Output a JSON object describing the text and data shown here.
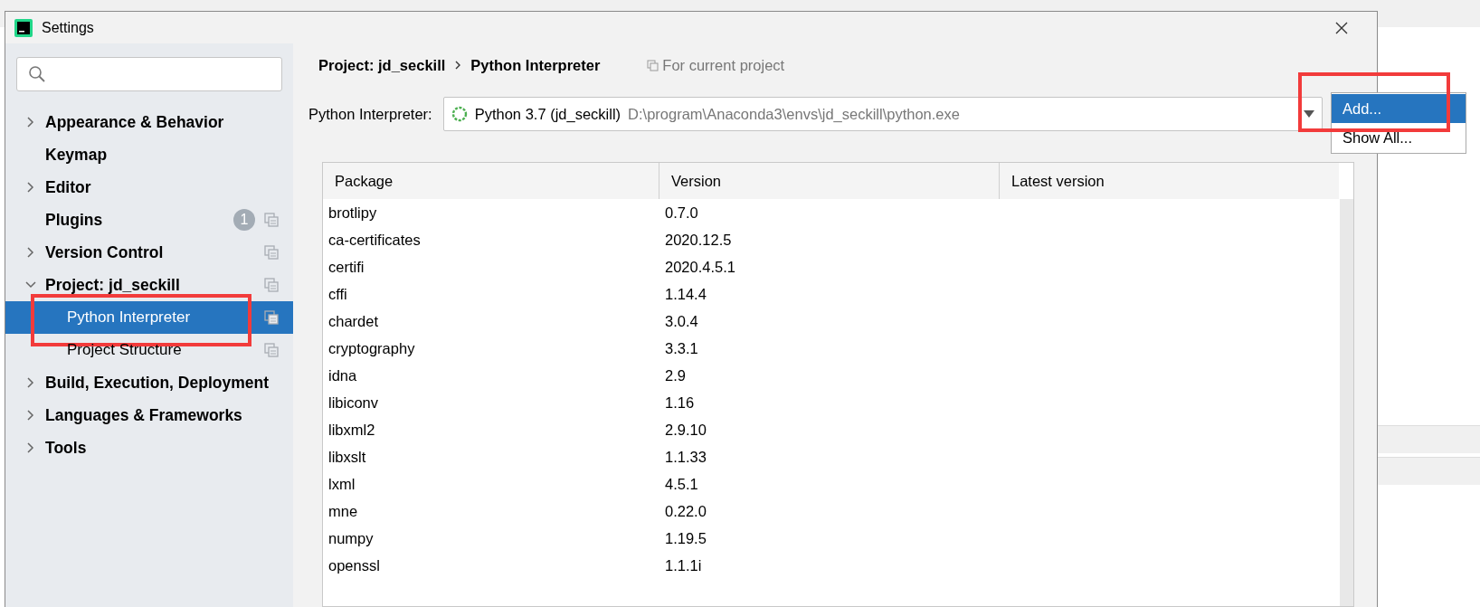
{
  "window": {
    "title": "Settings"
  },
  "sidebar": {
    "items": [
      {
        "label": "Appearance & Behavior",
        "kind": "group",
        "expanded": false,
        "selected": false,
        "project_scoped": false
      },
      {
        "label": "Keymap",
        "kind": "leaf",
        "selected": false,
        "project_scoped": false
      },
      {
        "label": "Editor",
        "kind": "group",
        "expanded": false,
        "selected": false,
        "project_scoped": false
      },
      {
        "label": "Plugins",
        "kind": "leaf",
        "selected": false,
        "project_scoped": true,
        "badge": "1"
      },
      {
        "label": "Version Control",
        "kind": "group",
        "expanded": false,
        "selected": false,
        "project_scoped": true
      },
      {
        "label": "Project: jd_seckill",
        "kind": "group",
        "expanded": true,
        "selected": false,
        "project_scoped": true,
        "children": [
          {
            "label": "Python Interpreter",
            "selected": true,
            "project_scoped": true,
            "highlighted": true
          },
          {
            "label": "Project Structure",
            "selected": false,
            "project_scoped": true,
            "highlighted": false
          }
        ]
      },
      {
        "label": "Build, Execution, Deployment",
        "kind": "group",
        "expanded": false,
        "selected": false,
        "project_scoped": false
      },
      {
        "label": "Languages & Frameworks",
        "kind": "group",
        "expanded": false,
        "selected": false,
        "project_scoped": false
      },
      {
        "label": "Tools",
        "kind": "group",
        "expanded": false,
        "selected": false,
        "project_scoped": false
      }
    ]
  },
  "breadcrumb": [
    "Project: jd_seckill",
    "Python Interpreter"
  ],
  "scope_note": "For current project",
  "interpreter": {
    "label": "Python Interpreter:",
    "name": "Python 3.7 (jd_seckill)",
    "path": "D:\\program\\Anaconda3\\envs\\jd_seckill\\python.exe"
  },
  "dropdown_menu": [
    {
      "label": "Add...",
      "selected": true,
      "highlighted": true
    },
    {
      "label": "Show All...",
      "selected": false,
      "highlighted": false
    }
  ],
  "table": {
    "columns": [
      "Package",
      "Version",
      "Latest version"
    ],
    "rows": [
      [
        "brotlipy",
        "0.7.0"
      ],
      [
        "ca-certificates",
        "2020.12.5"
      ],
      [
        "certifi",
        "2020.4.5.1"
      ],
      [
        "cffi",
        "1.14.4"
      ],
      [
        "chardet",
        "3.0.4"
      ],
      [
        "cryptography",
        "3.3.1"
      ],
      [
        "idna",
        "2.9"
      ],
      [
        "libiconv",
        "1.16"
      ],
      [
        "libxml2",
        "2.9.10"
      ],
      [
        "libxslt",
        "1.1.33"
      ],
      [
        "lxml",
        "4.5.1"
      ],
      [
        "mne",
        "0.22.0"
      ],
      [
        "numpy",
        "1.19.5"
      ],
      [
        "openssl",
        "1.1.1i"
      ]
    ]
  }
}
